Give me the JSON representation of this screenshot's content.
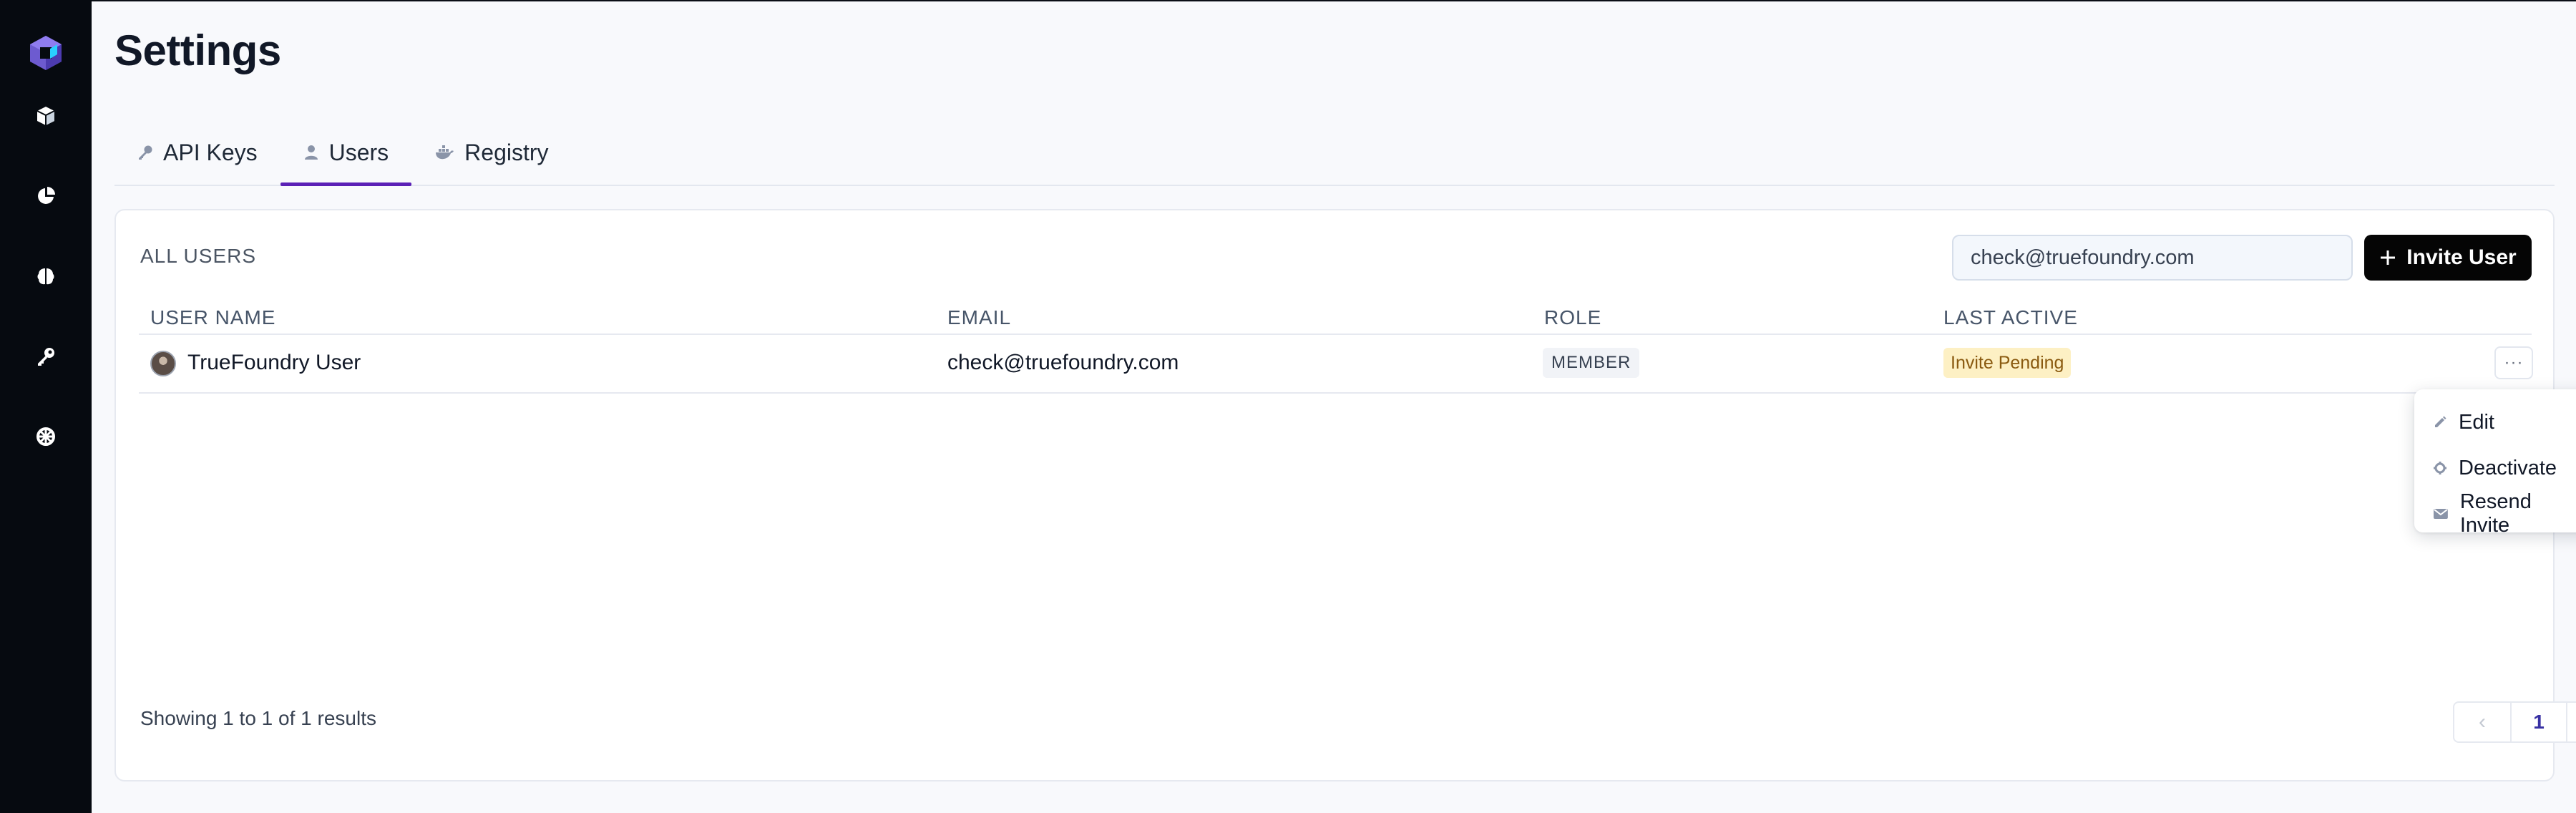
{
  "page": {
    "title": "Settings"
  },
  "tabs": [
    {
      "label": "API Keys",
      "icon": "key-icon"
    },
    {
      "label": "Users",
      "icon": "user-icon",
      "active": true
    },
    {
      "label": "Registry",
      "icon": "docker-icon"
    }
  ],
  "sidebar": {
    "logo": "truefoundry-logo",
    "icons": [
      "cube-icon",
      "pie-chart-icon",
      "brain-icon",
      "key-icon",
      "settings-wheel-icon"
    ]
  },
  "users_panel": {
    "section_label": "ALL USERS",
    "search_value": "check@truefoundry.com",
    "invite_label": "Invite User",
    "columns": [
      "USER NAME",
      "EMAIL",
      "ROLE",
      "LAST ACTIVE"
    ],
    "rows": [
      {
        "name": "TrueFoundry User",
        "email": "check@truefoundry.com",
        "role": "MEMBER",
        "last_active": "Invite Pending"
      }
    ],
    "more_label": "···",
    "menu": [
      {
        "label": "Edit",
        "icon": "pencil-icon"
      },
      {
        "label": "Deactivate",
        "icon": "gear-icon"
      },
      {
        "label": "Resend Invite",
        "icon": "envelope-icon"
      }
    ],
    "results_text": "Showing 1 to 1 of 1 results",
    "pagination": {
      "current_page": "1",
      "prev": "‹",
      "next": "›"
    }
  },
  "colors": {
    "sidebar_bg": "#060a10",
    "accent": "#5b21b6",
    "button_bg": "#050505",
    "pending_badge": "#fdf0c4"
  }
}
